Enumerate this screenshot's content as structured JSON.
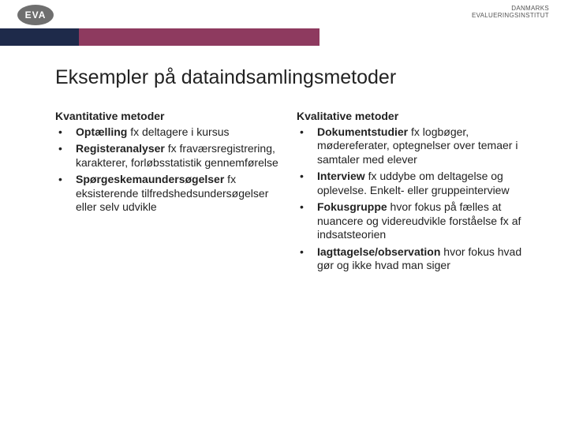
{
  "logo": "EVA",
  "org_line1": "DANMARKS",
  "org_line2": "EVALUERINGSINSTITUT",
  "title": "Eksempler på dataindsamlingsmetoder",
  "left": {
    "heading": "Kvantitative metoder",
    "items": [
      {
        "bold": "Optælling",
        "rest": " fx deltagere i kursus"
      },
      {
        "bold": "Registeranalyser",
        "rest": " fx fraværsregistrering, karakterer, forløbsstatistik gennemførelse"
      },
      {
        "bold": "Spørgeskemaundersøgelser",
        "rest": " fx eksisterende tilfredshedsundersøgelser eller selv udvikle"
      }
    ]
  },
  "right": {
    "heading": "Kvalitative metoder",
    "items": [
      {
        "bold": "Dokumentstudier",
        "rest": " fx logbøger, mødereferater, optegnelser over temaer i samtaler med elever"
      },
      {
        "bold": "Interview",
        "rest": " fx uddybe om deltagelse og oplevelse. Enkelt- eller gruppeinterview"
      },
      {
        "bold": "Fokusgruppe",
        "rest": " hvor fokus på fælles at nuancere og videreudvikle forståelse fx af indsatsteorien"
      },
      {
        "bold": "Iagttagelse/observation",
        "rest": " hvor fokus hvad gør og ikke hvad man siger"
      }
    ]
  }
}
